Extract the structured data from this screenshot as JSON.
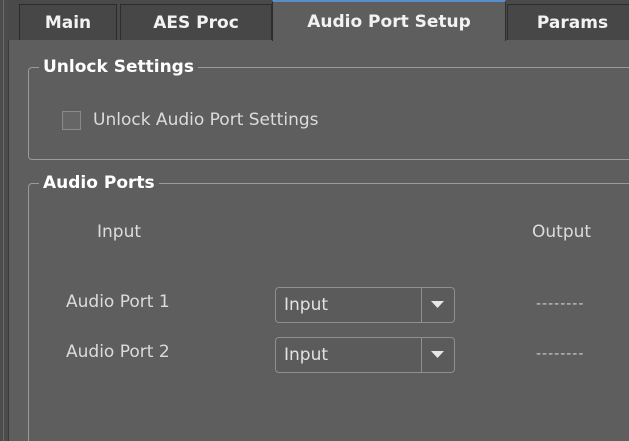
{
  "tabs": {
    "main": "Main",
    "aes_proc": "AES Proc",
    "audio_port_setup": "Audio Port Setup",
    "params": "Params"
  },
  "unlock_group": {
    "title": "Unlock Settings",
    "checkbox_label": "Unlock Audio Port Settings",
    "checked": false
  },
  "ports_group": {
    "title": "Audio Ports",
    "col_input": "Input",
    "col_output": "Output",
    "ports": [
      {
        "label": "Audio Port 1",
        "mode": "Input",
        "output": "--------"
      },
      {
        "label": "Audio Port 2",
        "mode": "Input",
        "output": "--------"
      }
    ]
  },
  "colors": {
    "panel": "#5e5e5e",
    "active_tab_accent": "#5b8ec8",
    "text": "#dcdcdc"
  }
}
